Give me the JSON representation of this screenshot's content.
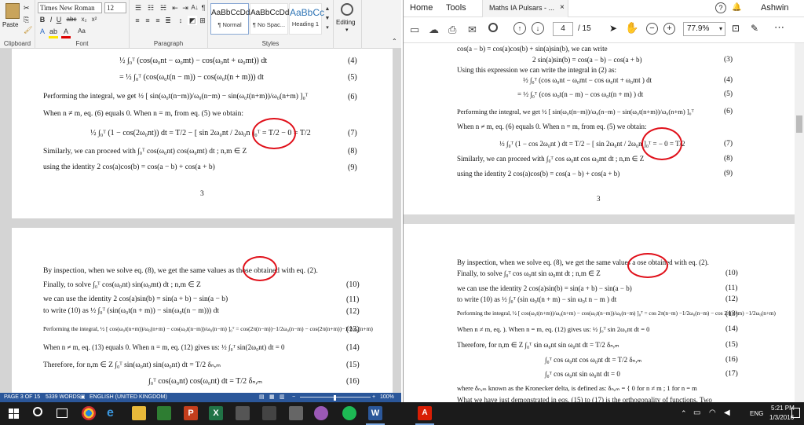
{
  "word": {
    "font_name": "Times New Roman",
    "font_size": "12",
    "paste_label": "Paste",
    "group_labels": {
      "clipboard": "Clipboard",
      "font": "Font",
      "paragraph": "Paragraph",
      "styles": "Styles"
    },
    "styles": [
      {
        "preview": "AaBbCcDd",
        "name": "¶ Normal"
      },
      {
        "preview": "AaBbCcDd",
        "name": "¶ No Spac..."
      },
      {
        "preview": "AaBbCc",
        "name": "Heading 1"
      }
    ],
    "editing_label": "Editing",
    "page3": {
      "lines": [
        {
          "text": "½ ∫₀ᵀ (cos(ω₀nt − ω₀mt) − cos(ω₀nt + ω₀mt)) dt",
          "num": "(4)"
        },
        {
          "text": "= ½ ∫₀ᵀ (cos(ω₀t(n − m)) − cos(ω₀t(n + m))) dt",
          "num": "(5)"
        },
        {
          "text": "Performing the integral, we get  ½ [ sin(ω₀t(n−m))/ω₀(n−m) − sin(ω₀t(n+m))/ω₀(n+m) ]₀ᵀ",
          "num": "(6)"
        },
        {
          "text": "When n ≠ m, eq. (6) equals 0. When n = m, from eq. (5) we obtain:",
          "num": ""
        },
        {
          "text": "½ ∫₀ᵀ (1 − cos(2ω₀nt)) dt  =  T/2 − [ sin 2ω₀nt / 2ω₀n ]₀ᵀ  =  T/2 − 0  =  T/2",
          "num": "(7)"
        },
        {
          "text": "Similarly, we can proceed with ∫₀ᵀ cos(ω₀nt) cos(ω₀mt) dt  ; n,m ∈ Z",
          "num": "(8)"
        },
        {
          "text": "using the identity        2 cos(a)cos(b) = cos(a − b) + cos(a + b)",
          "num": "(9)"
        }
      ],
      "page_number": "3"
    },
    "page4": {
      "lines": [
        {
          "text": "By inspection, when we solve eq. (8), we get the same values as those obtained with eq. (2).",
          "num": ""
        },
        {
          "text": "Finally, to solve                ∫₀ᵀ cos(ω₀nt) sin(ω₀mt) dt  ; n,m ∈ Z",
          "num": "(10)"
        },
        {
          "text": "we can use the identity        2 cos(a)sin(b) = sin(a + b) − sin(a − b)",
          "num": "(11)"
        },
        {
          "text": "to write (10) as               ½ ∫₀ᵀ (sin(ω₀t(n + m)) − sin(ω₀t(n − m))) dt",
          "num": "(12)"
        },
        {
          "text": "Performing the integral, ½ [ cos(ω₀t(n+m))/ω₀(n+m) − cos(ω₀t(n−m))/ω₀(n−m) ]₀ᵀ = cos(2π(n−m))−1/2ω₀(n−m) − cos(2π(n+m))−1/2ω₀(n+m)",
          "num": "(13)"
        },
        {
          "text": "When n ≠ m, eq. (13) equals 0. When n = m, eq. (12) gives us:  ½ ∫₀ᵀ sin(2ω₀nt) dt = 0",
          "num": "(14)"
        },
        {
          "text": "Therefore, for n,m ∈ Z          ∫₀ᵀ sin(ω₀nt) sin(ω₀nt) dt = T/2 δₙ,ₘ",
          "num": "(15)"
        },
        {
          "text": "∫₀ᵀ cos(ω₀nt) cos(ω₀nt) dt = T/2 δₙ,ₘ",
          "num": "(16)"
        }
      ]
    },
    "status": {
      "page": "PAGE 3 OF 15",
      "words": "5339 WORDS",
      "language": "ENGLISH (UNITED KINGDOM)",
      "zoom": "100%"
    }
  },
  "pdf": {
    "tabs": {
      "home": "Home",
      "tools": "Tools",
      "document": "Maths IA Pulsars - ..."
    },
    "user": "Ashwin",
    "page_current": "4",
    "page_total": "/ 15",
    "zoom": "77.9%",
    "page3": {
      "lines": [
        {
          "text": "cos(a − b) = cos(a)cos(b) + sin(a)sin(b), we can write",
          "num": ""
        },
        {
          "text": "2 sin(a)sin(b) = cos(a − b) − cos(a + b)",
          "num": "(3)"
        },
        {
          "text": "Using this expression we can write the integral in (2) as:",
          "num": ""
        },
        {
          "text": "½ ∫₀ᵀ (cos ω₀nt − ω₀mt  − cos ω₀nt + ω₀mt ) dt",
          "num": "(4)"
        },
        {
          "text": "= ½ ∫₀ᵀ (cos ω₀t(n − m)  − cos ω₀t(n + m) ) dt",
          "num": "(5)"
        },
        {
          "text": "Performing the integral, we get  ½ [ sin(ω₀t(n−m))/ω₀(n−m) − sin(ω₀t(n+m))/ω₀(n+m) ]₀ᵀ",
          "num": "(6)"
        },
        {
          "text": "When n ≠ m, eq. (6) equals 0. When n = m, from eq. (5) we obtain:",
          "num": ""
        },
        {
          "text": "½ ∫₀ᵀ (1 − cos 2ω₀nt ) dt  =  T/2 − [ sin 2ω₀nt / 2ω₀n ]₀ᵀ  =     − 0  =  T/2",
          "num": "(7)"
        },
        {
          "text": "Similarly, we can proceed with ∫₀ᵀ cos ω₀nt  cos ω₀mt  dt ; n,m ∈ Z",
          "num": "(8)"
        },
        {
          "text": "using the identity       2 cos(a)cos(b) = cos(a − b) + cos(a + b)",
          "num": "(9)"
        }
      ],
      "page_number": "3"
    },
    "page4": {
      "lines": [
        {
          "text": "By inspection, when we solve eq. (8), we get the same values a   ose obtained with eq. (2).",
          "num": ""
        },
        {
          "text": "Finally, to solve               ∫₀ᵀ cos ω₀nt  sin ω₀mt  dt  ; n,m ∈ Z",
          "num": "(10)"
        },
        {
          "text": "we can use the identity     2 cos(a)sin(b) = sin(a + b) − sin(a − b)",
          "num": "(11)"
        },
        {
          "text": "to write (10) as             ½ ∫₀ᵀ (sin ω₀t(n + m)  − sin ω₀t n − m ) dt",
          "num": "(12)"
        },
        {
          "text": "Performing the integral, ½ [ cos(ω₀t(n+m))/ω₀(n+m) − cos(ω₀t(n−m))/ω₀(n−m) ]₀ᵀ = cos 2π(n−m) −1/2ω₀(n−m) − cos 2π(n+m) −1/2ω₀(n+m)",
          "num": "(13)"
        },
        {
          "text": "When n ≠ m, eq.             ). When n = m, eq. (12) gives us:  ½ ∫₀ᵀ sin 2ω₀nt dt = 0",
          "num": "(14)"
        },
        {
          "text": "Therefore, for n,m ∈ Z         ∫₀ᵀ sin ω₀nt  sin ω₀nt  dt = T/2 δₙ,ₘ",
          "num": "(15)"
        },
        {
          "text": "∫₀ᵀ cos ω₀nt  cos ω₀nt  dt = T/2 δₙ,ₘ",
          "num": "(16)"
        },
        {
          "text": "∫₀ᵀ cos ω₀nt  sin ω₀nt  dt = 0",
          "num": "(17)"
        },
        {
          "text": "where δₙ,ₘ known as the Kronecker delta, is defined as:  δₙ,ₘ = { 0  for n ≠ m ; 1  for n = m",
          "num": ""
        },
        {
          "text": "What we have just demonstrated in eqs. (15) to (17) is the orthogonality of functions. Two",
          "num": ""
        }
      ]
    }
  },
  "taskbar": {
    "language": "ENG",
    "time": "5:21 PM",
    "date": "1/3/2016"
  }
}
